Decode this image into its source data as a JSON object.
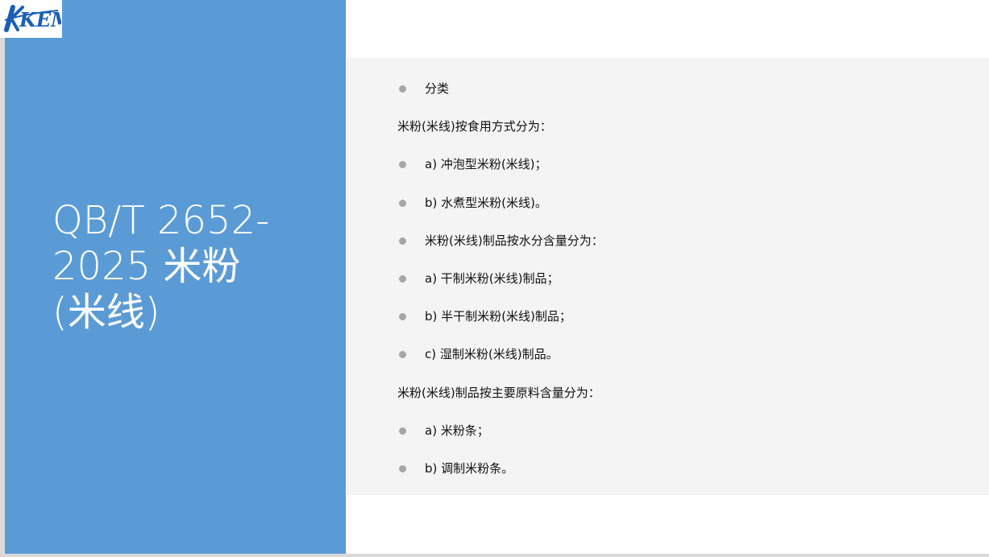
{
  "logo": {
    "text": "KEM",
    "color": "#1a5fb4"
  },
  "colors": {
    "left_panel": "#5b9bd5",
    "content_panel": "#f4f4f4",
    "bullet": "#a6a6a6"
  },
  "slide": {
    "title": "QB/T 2652-\n2025 米粉\n(米线)"
  },
  "content": {
    "items": [
      {
        "type": "bullet",
        "text": "分类"
      },
      {
        "type": "plain",
        "text": "米粉(米线)按食用方式分为："
      },
      {
        "type": "bullet",
        "text": "a) 冲泡型米粉(米线)；"
      },
      {
        "type": "bullet",
        "text": "b) 水煮型米粉(米线)。"
      },
      {
        "type": "bullet",
        "text": "米粉(米线)制品按水分含量分为："
      },
      {
        "type": "bullet",
        "text": "a) 干制米粉(米线)制品；"
      },
      {
        "type": "bullet",
        "text": "b) 半干制米粉(米线)制品；"
      },
      {
        "type": "bullet",
        "text": "c) 湿制米粉(米线)制品。"
      },
      {
        "type": "plain",
        "text": "米粉(米线)制品按主要原料含量分为："
      },
      {
        "type": "bullet",
        "text": "a) 米粉条；"
      },
      {
        "type": "bullet",
        "text": "b) 调制米粉条。"
      }
    ]
  }
}
